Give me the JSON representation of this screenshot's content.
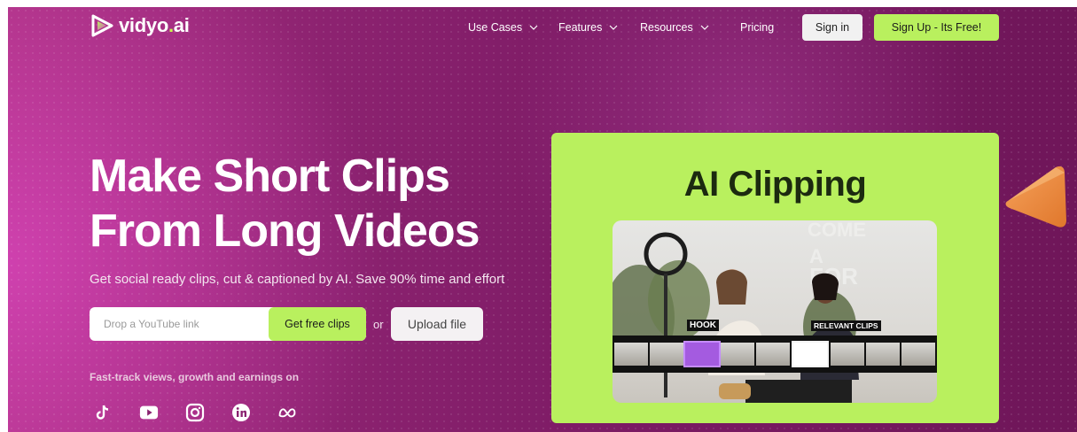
{
  "brand": {
    "name_part1": "vidyo",
    "name_dot": ".",
    "name_part2": "ai",
    "accent": "#b9f05e",
    "background": "#8c2270"
  },
  "nav": {
    "items": [
      {
        "label": "Use Cases",
        "dropdown": true
      },
      {
        "label": "Features",
        "dropdown": true
      },
      {
        "label": "Resources",
        "dropdown": true
      },
      {
        "label": "Pricing",
        "dropdown": false
      }
    ],
    "sign_in": "Sign in",
    "sign_up": "Sign Up - Its Free!"
  },
  "hero": {
    "title_line1": "Make Short Clips",
    "title_line2": "From Long Videos",
    "subtitle": "Get social ready clips, cut & captioned by AI. Save 90% time and effort",
    "input_placeholder": "Drop a YouTube link",
    "cta": "Get free clips",
    "or": "or",
    "upload": "Upload file",
    "fast_track": "Fast-track views, growth and earnings on",
    "socials": [
      "tiktok-icon",
      "youtube-icon",
      "instagram-icon",
      "linkedin-icon",
      "meta-icon"
    ]
  },
  "card": {
    "title": "AI Clipping",
    "tag_hook": "HOOK",
    "tag_relevant": "RELEVANT CLIPS"
  }
}
